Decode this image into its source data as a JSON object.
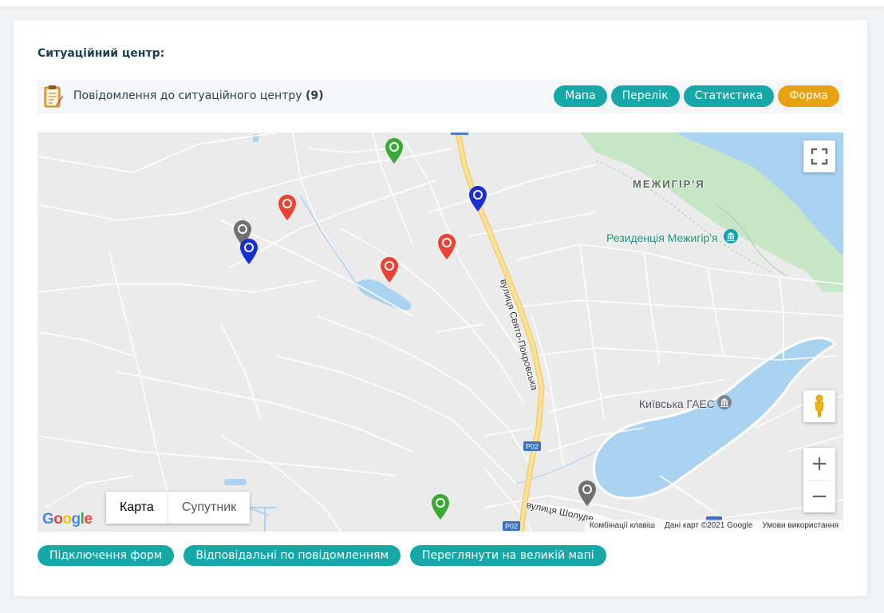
{
  "section_title": "Ситуаційний центр:",
  "toolbar": {
    "text": "Повідомлення до ситуаційного центру",
    "count": "(9)",
    "buttons": [
      "Мапа",
      "Перелік",
      "Статистика",
      "Форма"
    ],
    "active_index": 3
  },
  "map": {
    "labels": {
      "mezhyhirya": "МЕЖИГІР'Я",
      "residence": "Резиденція Межигір'я",
      "ges": "Київська ГАЕС",
      "street_main": "вулиця Свято-Покровська",
      "street_sholud": "вулиця Шолуде",
      "road_p02_a": "P02",
      "road_p02_b": "P02"
    },
    "map_type": {
      "map": "Карта",
      "satellite": "Супутник"
    },
    "google": "Google",
    "attribution": {
      "shortcuts": "Комбінації клавіш",
      "data": "Дані карт ©2021 Google",
      "terms": "Умови використання"
    },
    "marker_colors": {
      "red": "#e94336",
      "green": "#3aa935",
      "blue": "#1730cf",
      "gray": "#707070"
    }
  },
  "bottom_buttons": [
    "Підключення форм",
    "Відповідальні по повідомленням",
    "Переглянути на великій мапі"
  ],
  "colors": {
    "teal": "#16a7a7",
    "orange": "#e9a10f",
    "title": "#1c3f4f"
  }
}
